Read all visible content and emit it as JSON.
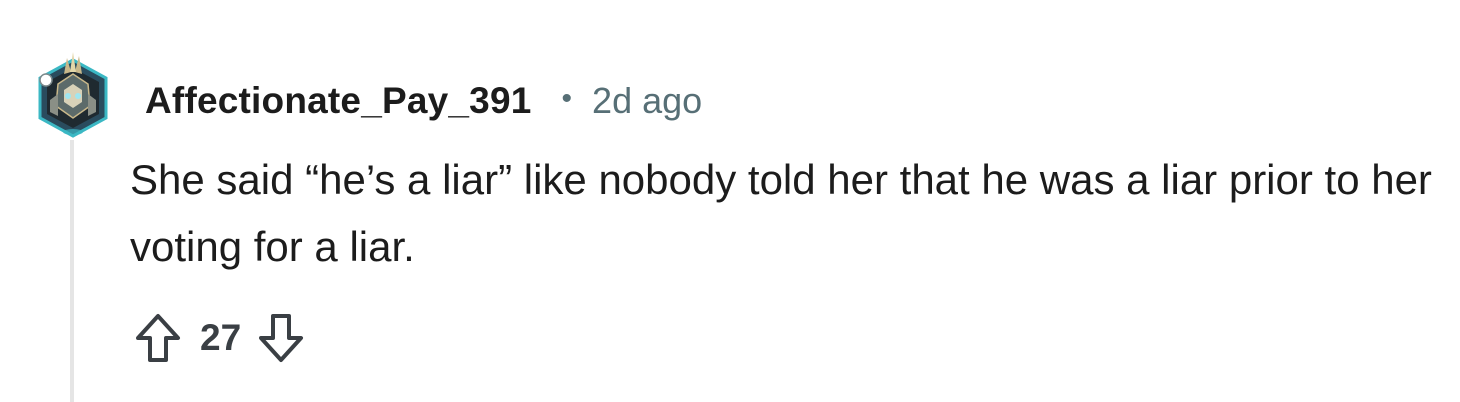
{
  "comment": {
    "author": "Affectionate_Pay_391",
    "separator": "•",
    "timestamp": "2d ago",
    "body": "She said “he’s a liar” like nobody told her that he was a liar prior to her voting for a liar.",
    "score": "27"
  },
  "icons": {
    "avatar": "avatar-icon",
    "upvote": "upvote-arrow-icon",
    "downvote": "downvote-arrow-icon"
  },
  "colors": {
    "text": "#1c1c1c",
    "meta": "#576f76",
    "thread_line": "#e5e5e5",
    "avatar_ring": "#3bb8c4"
  }
}
